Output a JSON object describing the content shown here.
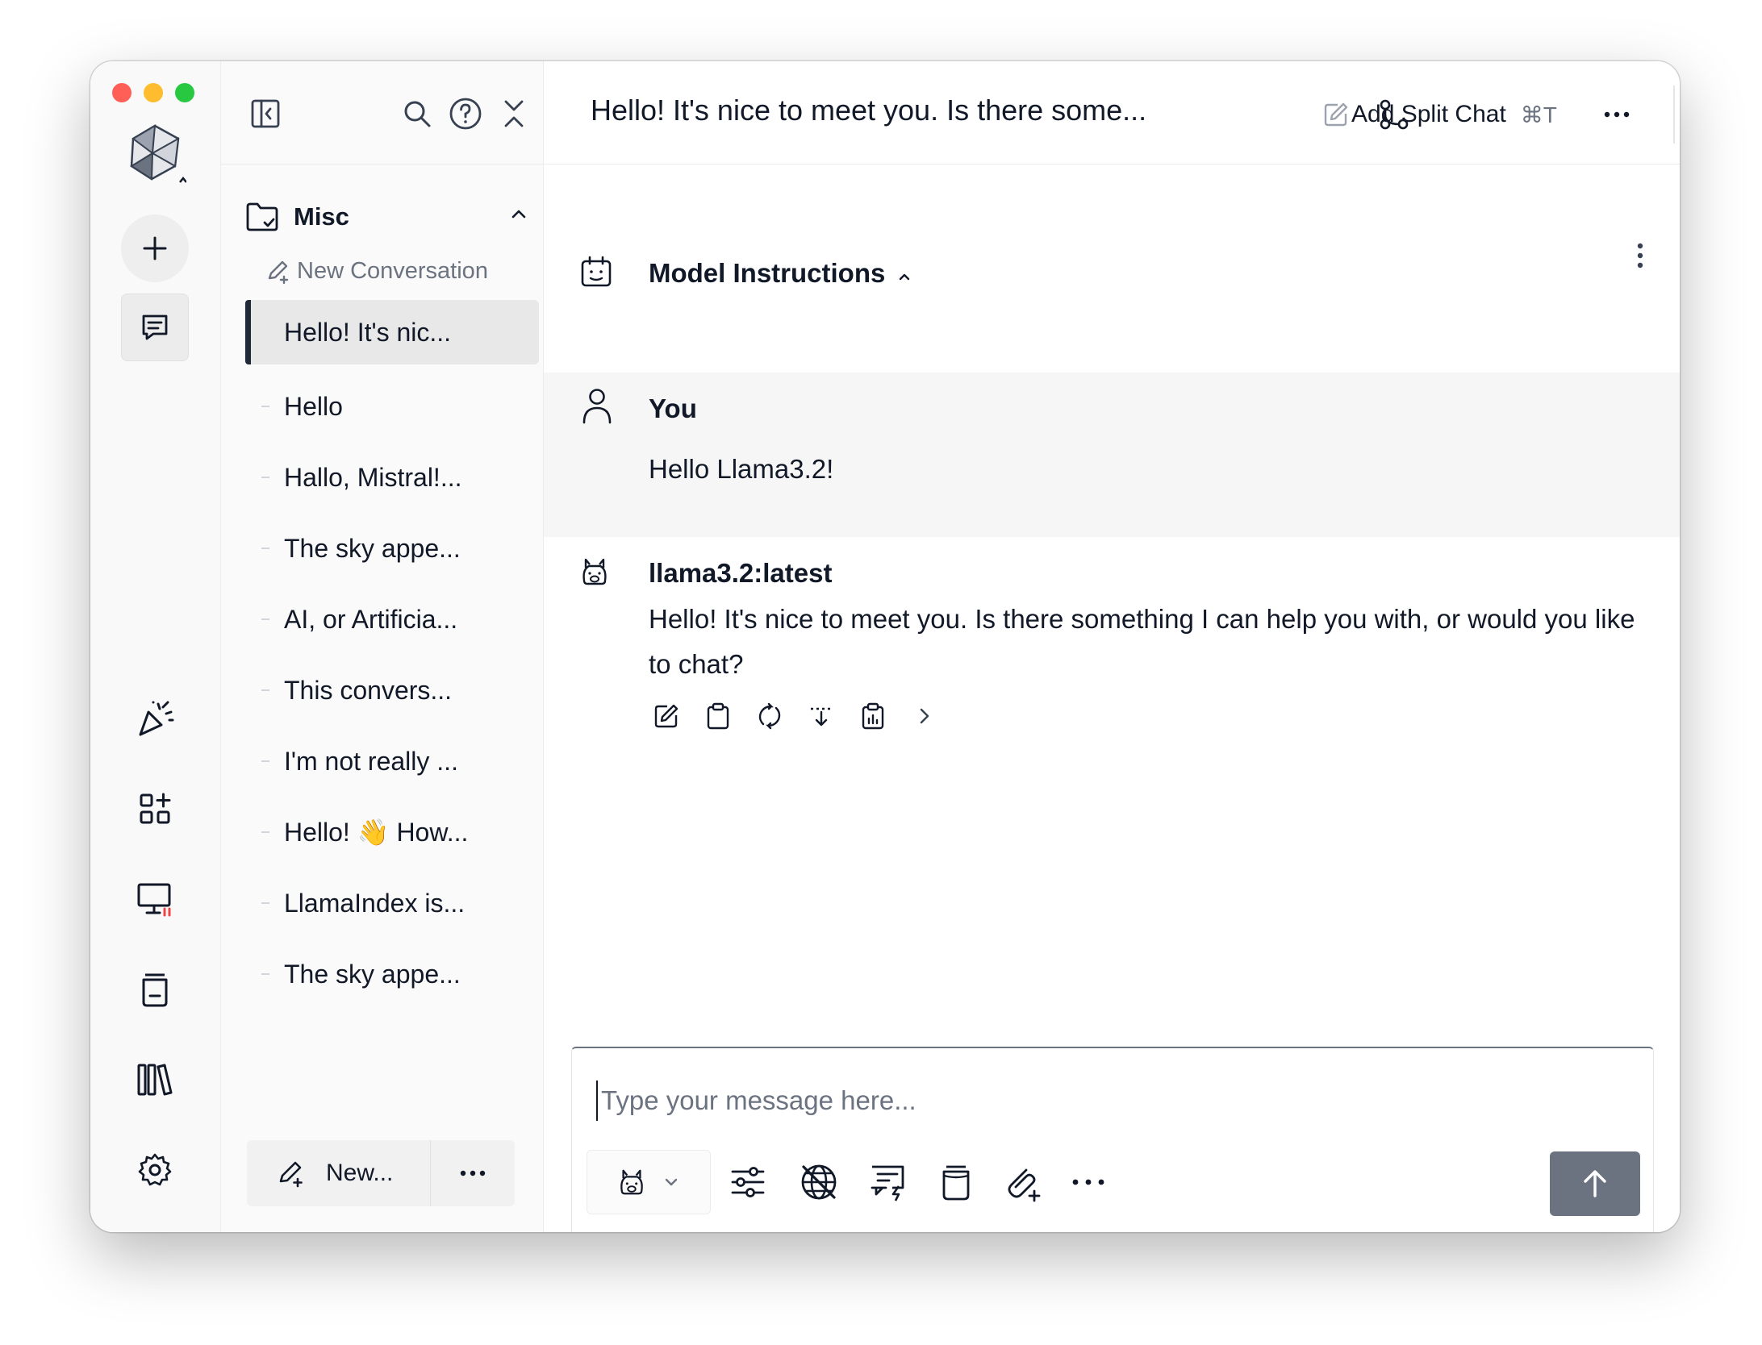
{
  "window": {
    "traffic_lights": [
      "close",
      "minimize",
      "maximize"
    ]
  },
  "rail": {
    "icons": [
      "app-logo-icon",
      "new-chat-icon",
      "chat-icon",
      "party-icon",
      "apps-icon",
      "monitor-icon",
      "knowledge-jar-icon",
      "library-icon",
      "settings-icon"
    ]
  },
  "sidebar": {
    "folder": {
      "label": "Misc",
      "icon": "folder-icon"
    },
    "new_conversation": "New Conversation",
    "conversations": [
      {
        "label": "Hello! It's nic...",
        "active": true
      },
      {
        "label": "Hello"
      },
      {
        "label": "Hallo, Mistral!..."
      },
      {
        "label": "The sky appe..."
      },
      {
        "label": "AI, or Artificia..."
      },
      {
        "label": "This convers..."
      },
      {
        "label": "I'm not really ..."
      },
      {
        "label": "Hello! 👋 How..."
      },
      {
        "label": "LlamaIndex is..."
      },
      {
        "label": "The sky appe..."
      }
    ],
    "footer": {
      "new_label": "New..."
    }
  },
  "topbar": {
    "title": "Hello! It's nice to meet you. Is there some...",
    "split_label": "Add Split Chat",
    "split_shortcut": "⌘T"
  },
  "instructions": {
    "label": "Model Instructions"
  },
  "messages": {
    "user": {
      "author": "You",
      "text": "Hello Llama3.2!"
    },
    "assistant": {
      "author": "llama3.2:latest",
      "text": "Hello! It's nice to meet you. Is there something I can help you with, or would you like to chat?"
    }
  },
  "composer": {
    "placeholder": "Type your message here..."
  },
  "colors": {
    "accent": "#111827",
    "send_button": "#6b7280",
    "active_row": "#e8e8e8"
  }
}
